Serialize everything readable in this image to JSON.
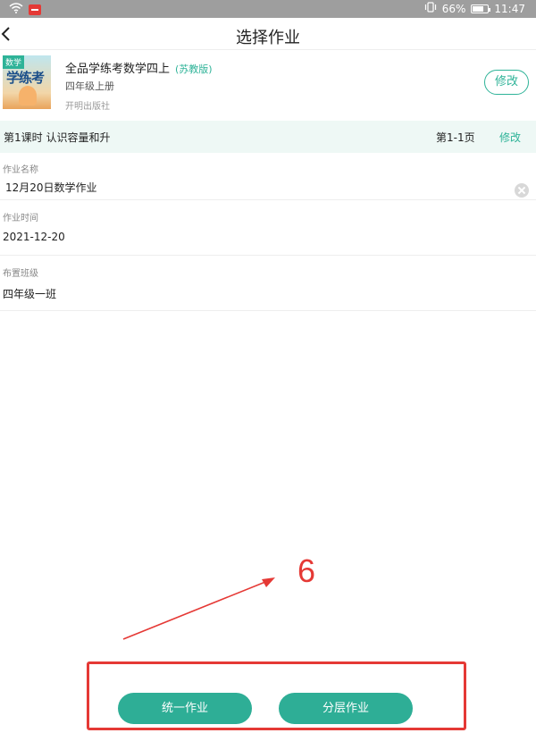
{
  "status_bar": {
    "battery_percent": "66%",
    "battery_level": 0.66,
    "time": "11:47",
    "icons": [
      "wifi-icon",
      "app-notification-icon",
      "vibrate-icon",
      "battery-icon"
    ],
    "background_color": "#9e9e9e"
  },
  "header": {
    "title": "选择作业",
    "back_icon": "chevron-left-icon"
  },
  "book": {
    "cover_tag": "数学",
    "cover_title": "学练考",
    "name": "全品学练考数学四上",
    "edition": "(苏教版)",
    "grade": "四年级上册",
    "publisher": "开明出版社",
    "edit_label": "修改"
  },
  "lesson": {
    "title": "第1课时 认识容量和升",
    "pages": "第1-1页",
    "edit_label": "修改"
  },
  "form": {
    "name_label": "作业名称",
    "name_value": "12月20日数学作业",
    "time_label": "作业时间",
    "time_value": "2021-12-20",
    "class_label": "布置班级",
    "class_value": "四年级一班"
  },
  "annotation": {
    "number": "6",
    "color": "#e53935"
  },
  "actions": {
    "unified_label": "统一作业",
    "layered_label": "分层作业"
  },
  "colors": {
    "accent": "#2eb398",
    "button": "#2eae96",
    "lesson_bg": "#eef8f5"
  }
}
